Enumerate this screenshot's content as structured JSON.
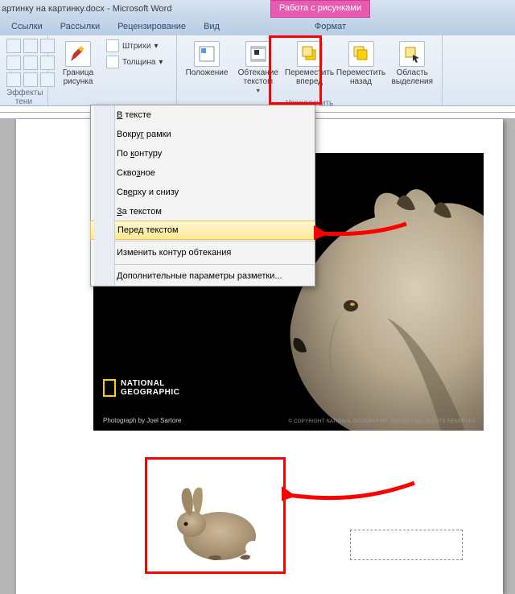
{
  "title": "артинку на картинку.docx - Microsoft Word",
  "context_tab": "Работа с рисунками",
  "tabs": {
    "links": "Ссылки",
    "mail": "Рассылки",
    "review": "Рецензирование",
    "view": "Вид",
    "format": "Формат"
  },
  "ribbon": {
    "effects": "екты\nни",
    "shadow_effects": "Эффекты тени",
    "border": "Граница\nрисунка",
    "hatch": "Штрихи",
    "weight": "Толщина",
    "position": "Положение",
    "wrap": "Обтекание\nтекстом",
    "bring_fwd": "Переместить\nвперед",
    "send_back": "Переместить\nназад",
    "selection": "Область\nвыделения",
    "arrange": "Упорядочить"
  },
  "dropdown": {
    "inline": "В тексте",
    "square": "Вокруг рамки",
    "tight": "По контуру",
    "through": "Сквозное",
    "topbottom": "Сверху и снизу",
    "behind": "За текстом",
    "front": "Перед текстом",
    "edit": "Изменить контур обтекания",
    "more": "Дополнительные параметры разметки..."
  },
  "natgeo": {
    "line1": "NATIONAL",
    "line2": "GEOGRAPHIC"
  },
  "credit": "Photograph by Joel Sartore",
  "copyright": "© COPYRIGHT NATIONAL GEOGRAPHIC SOCIETY. ALL RIGHTS RESERVED."
}
